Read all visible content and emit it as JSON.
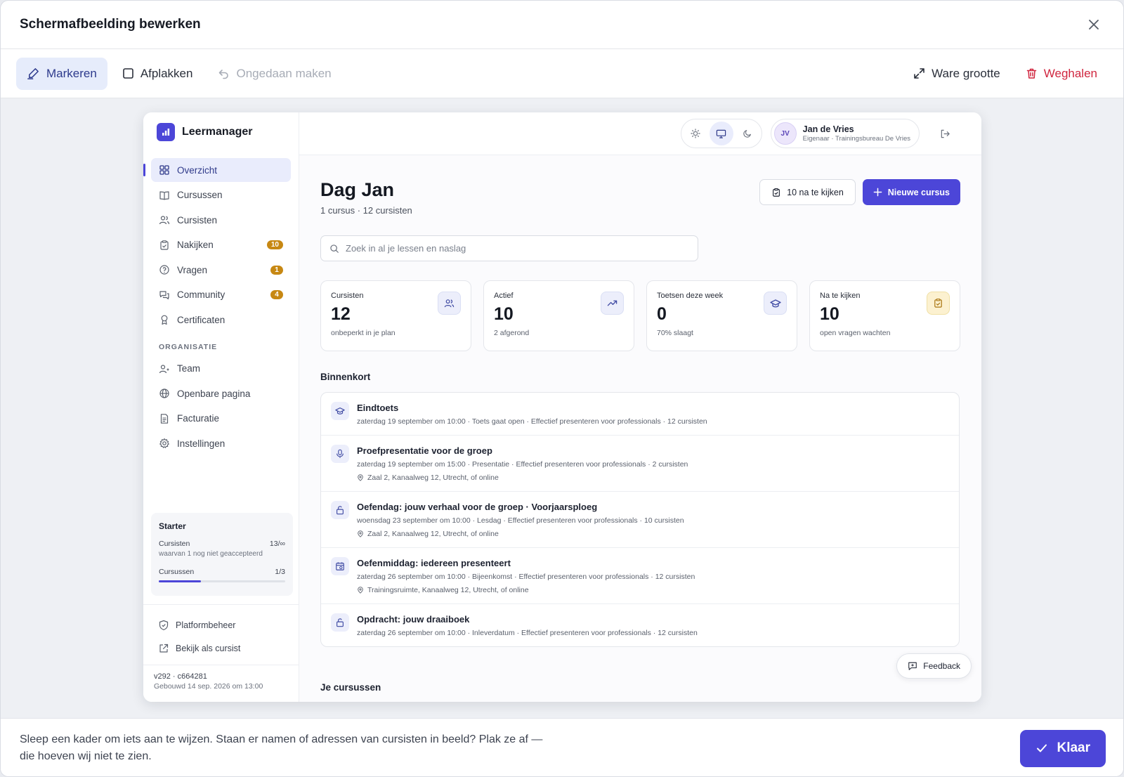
{
  "modal": {
    "title": "Schermafbeelding bewerken",
    "toolbar": {
      "mark": "Markeren",
      "redact": "Afplakken",
      "undo": "Ongedaan maken",
      "actual_size": "Ware grootte",
      "remove": "Weghalen"
    },
    "footer": {
      "hint": "Sleep een kader om iets aan te wijzen. Staan er namen of adressen van cursisten in beeld? Plak ze af — die hoeven wij niet te zien.",
      "done": "Klaar"
    }
  },
  "app": {
    "brand": "Leermanager",
    "nav": [
      {
        "label": "Overzicht",
        "icon": "grid-icon",
        "active": true,
        "badge": ""
      },
      {
        "label": "Cursussen",
        "icon": "book-icon",
        "active": false,
        "badge": ""
      },
      {
        "label": "Cursisten",
        "icon": "users-icon",
        "active": false,
        "badge": ""
      },
      {
        "label": "Nakijken",
        "icon": "clipboard-icon",
        "active": false,
        "badge": "10"
      },
      {
        "label": "Vragen",
        "icon": "help-icon",
        "active": false,
        "badge": "1"
      },
      {
        "label": "Community",
        "icon": "chat-icon",
        "active": false,
        "badge": "4"
      },
      {
        "label": "Certificaten",
        "icon": "award-icon",
        "active": false,
        "badge": ""
      }
    ],
    "section_org": "ORGANISATIE",
    "nav_org": [
      {
        "label": "Team",
        "icon": "team-icon"
      },
      {
        "label": "Openbare pagina",
        "icon": "globe-icon"
      },
      {
        "label": "Facturatie",
        "icon": "invoice-icon"
      },
      {
        "label": "Instellingen",
        "icon": "gear-icon"
      }
    ],
    "plan": {
      "name": "Starter",
      "students_label": "Cursisten",
      "students_value": "13/∞",
      "students_sub": "waarvan 1 nog niet geaccepteerd",
      "courses_label": "Cursussen",
      "courses_value": "1/3",
      "courses_fraction": 0.333
    },
    "footer_links": {
      "admin": "Platformbeheer",
      "view_as": "Bekijk als cursist"
    },
    "version": {
      "line1": "v292 · c664281",
      "line2": "Gebouwd 14 sep. 2026 om 13:00"
    },
    "user": {
      "initials": "JV",
      "name": "Jan de Vries",
      "role": "Eigenaar · Trainingsbureau De Vries"
    },
    "greeting": "Dag Jan",
    "greeting_sub": "1 cursus · 12 cursisten",
    "review_button": "10 na te kijken",
    "new_course_button": "Nieuwe cursus",
    "search_placeholder": "Zoek in al je lessen en naslag",
    "stats": [
      {
        "label": "Cursisten",
        "value": "12",
        "sub": "onbeperkt in je plan",
        "icon": "users-icon"
      },
      {
        "label": "Actief",
        "value": "10",
        "sub": "2 afgerond",
        "icon": "trending-icon"
      },
      {
        "label": "Toetsen deze week",
        "value": "0",
        "sub": "70% slaagt",
        "icon": "graduation-icon"
      },
      {
        "label": "Na te kijken",
        "value": "10",
        "sub": "open vragen wachten",
        "icon": "clipboard-icon"
      }
    ],
    "upcoming_title": "Binnenkort",
    "upcoming": [
      {
        "title": "Eindtoets",
        "meta": "zaterdag 19 september om 10:00 · Toets gaat open · Effectief presenteren voor professionals · 12 cursisten",
        "location": "",
        "icon": "graduation-icon"
      },
      {
        "title": "Proefpresentatie voor de groep",
        "meta": "zaterdag 19 september om 15:00 · Presentatie · Effectief presenteren voor professionals · 2 cursisten",
        "location": "Zaal 2, Kanaalweg 12, Utrecht, of online",
        "icon": "mic-icon"
      },
      {
        "title": "Oefendag: jouw verhaal voor de groep · Voorjaarsploeg",
        "meta": "woensdag 23 september om 10:00 · Lesdag · Effectief presenteren voor professionals · 10 cursisten",
        "location": "Zaal 2, Kanaalweg 12, Utrecht, of online",
        "icon": "unlock-icon"
      },
      {
        "title": "Oefenmiddag: iedereen presenteert",
        "meta": "zaterdag 26 september om 10:00 · Bijeenkomst · Effectief presenteren voor professionals · 12 cursisten",
        "location": "Trainingsruimte, Kanaalweg 12, Utrecht, of online",
        "icon": "calendar-icon"
      },
      {
        "title": "Opdracht: jouw draaiboek",
        "meta": "zaterdag 26 september om 10:00 · Inleverdatum · Effectief presenteren voor professionals · 12 cursisten",
        "location": "",
        "icon": "unlock-icon"
      }
    ],
    "courses_title": "Je cursussen",
    "feedback": "Feedback"
  }
}
